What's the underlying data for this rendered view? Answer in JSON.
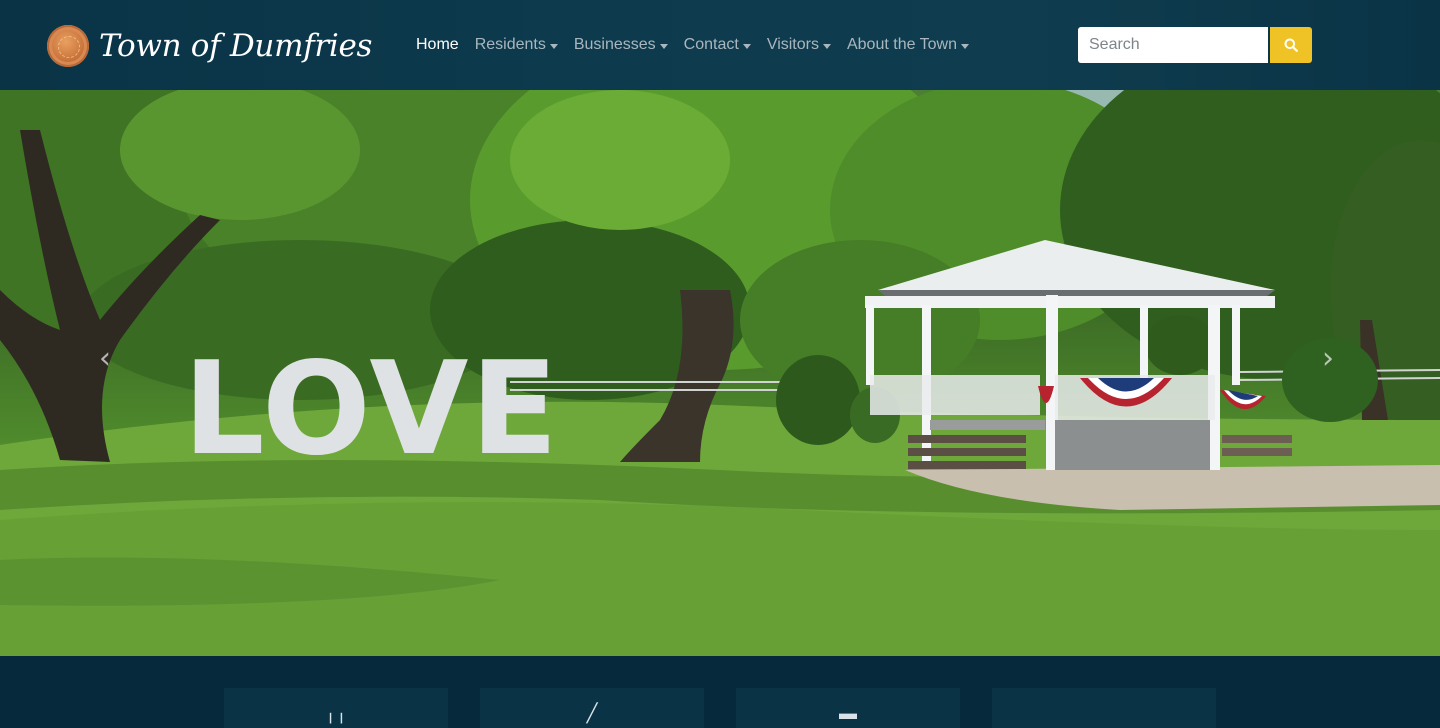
{
  "brand": {
    "name": "Town of Dumfries",
    "seal_icon": "town-seal-icon"
  },
  "nav": {
    "items": [
      {
        "label": "Home",
        "active": true,
        "dropdown": false
      },
      {
        "label": "Residents",
        "active": false,
        "dropdown": true
      },
      {
        "label": "Businesses",
        "active": false,
        "dropdown": true
      },
      {
        "label": "Contact",
        "active": false,
        "dropdown": true
      },
      {
        "label": "Visitors",
        "active": false,
        "dropdown": true
      },
      {
        "label": "About the Town",
        "active": false,
        "dropdown": true
      }
    ]
  },
  "search": {
    "placeholder": "Search",
    "value": "",
    "button_icon": "search-icon"
  },
  "hero": {
    "sign_text": "LOVE",
    "prev_icon": "chevron-left-icon",
    "next_icon": "chevron-right-icon"
  },
  "feature_cards": [
    {
      "icon": "card-icon-1"
    },
    {
      "icon": "card-icon-2"
    },
    {
      "icon": "card-icon-3"
    },
    {
      "icon": "card-icon-4"
    }
  ],
  "colors": {
    "navbar": "#0d3a4d",
    "accent": "#efc226",
    "band": "#062a3c",
    "nav_text": "#aab6bd",
    "nav_active": "#ffffff"
  }
}
